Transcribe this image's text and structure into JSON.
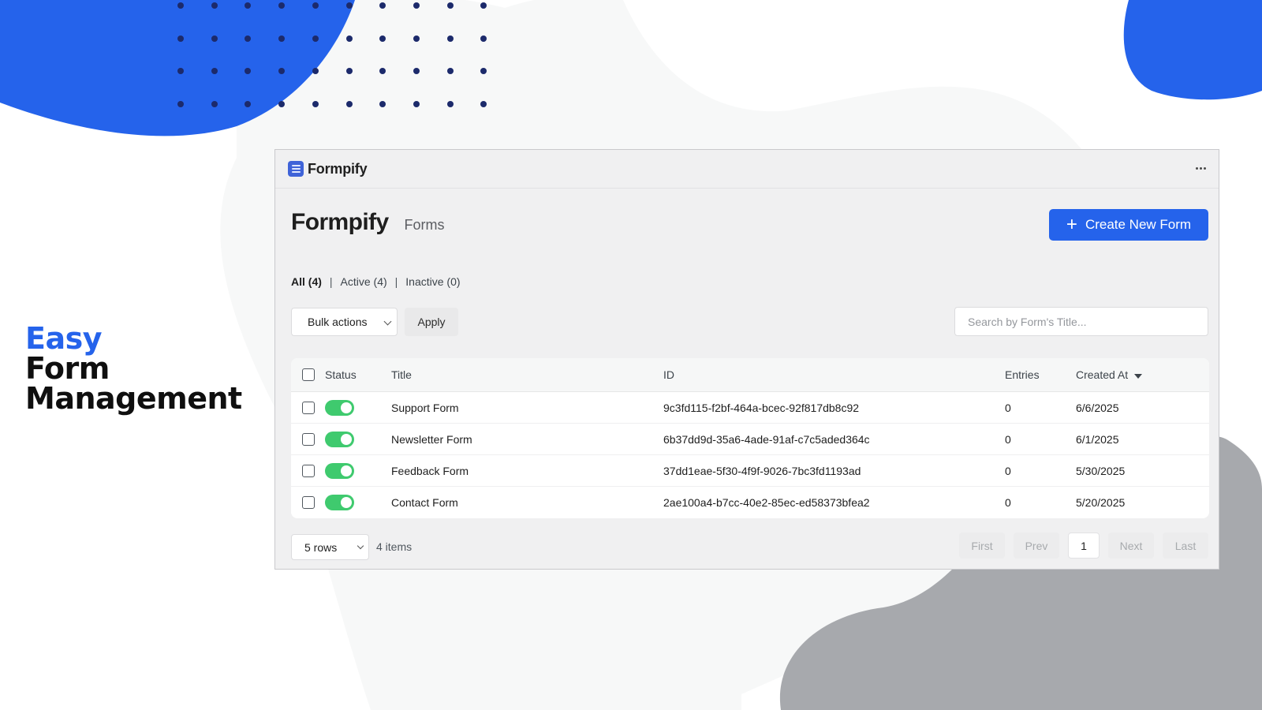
{
  "tagline": {
    "line1": "Easy",
    "line2": "Form",
    "line3": "Management"
  },
  "colors": {
    "accent": "#2563eb",
    "blob_gray": "#a7a9ac",
    "dot_navy": "#1c2a6b",
    "toggle_on": "#3fca6e"
  },
  "window": {
    "title": "Formpify",
    "menu_icon": "more-horizontal-icon"
  },
  "header": {
    "brand": "Formpify",
    "breadcrumb": "Forms",
    "create_label": "Create New Form",
    "create_icon": "plus-icon"
  },
  "filters": [
    {
      "label": "All (4)",
      "active": true
    },
    {
      "label": "Active (4)",
      "active": false
    },
    {
      "label": "Inactive (0)",
      "active": false
    }
  ],
  "toolbar": {
    "bulk_actions": "Bulk actions",
    "apply": "Apply",
    "search_placeholder": "Search by Form's Title..."
  },
  "table": {
    "columns": {
      "status": "Status",
      "title": "Title",
      "id": "ID",
      "entries": "Entries",
      "created_at": "Created At"
    },
    "rows": [
      {
        "status": "on",
        "title": "Support Form",
        "id": "9c3fd115-f2bf-464a-bcec-92f817db8c92",
        "entries": "0",
        "created_at": "6/6/2025"
      },
      {
        "status": "on",
        "title": "Newsletter Form",
        "id": "6b37dd9d-35a6-4ade-91af-c7c5aded364c",
        "entries": "0",
        "created_at": "6/1/2025"
      },
      {
        "status": "on",
        "title": "Feedback Form",
        "id": "37dd1eae-5f30-4f9f-9026-7bc3fd1193ad",
        "entries": "0",
        "created_at": "5/30/2025"
      },
      {
        "status": "on",
        "title": "Contact Form",
        "id": "2ae100a4-b7cc-40e2-85ec-ed58373bfea2",
        "entries": "0",
        "created_at": "5/20/2025"
      }
    ]
  },
  "pagination": {
    "rows_per_page": "5 rows",
    "items_count": "4 items",
    "first": "First",
    "prev": "Prev",
    "current_page": "1",
    "next": "Next",
    "last": "Last"
  }
}
